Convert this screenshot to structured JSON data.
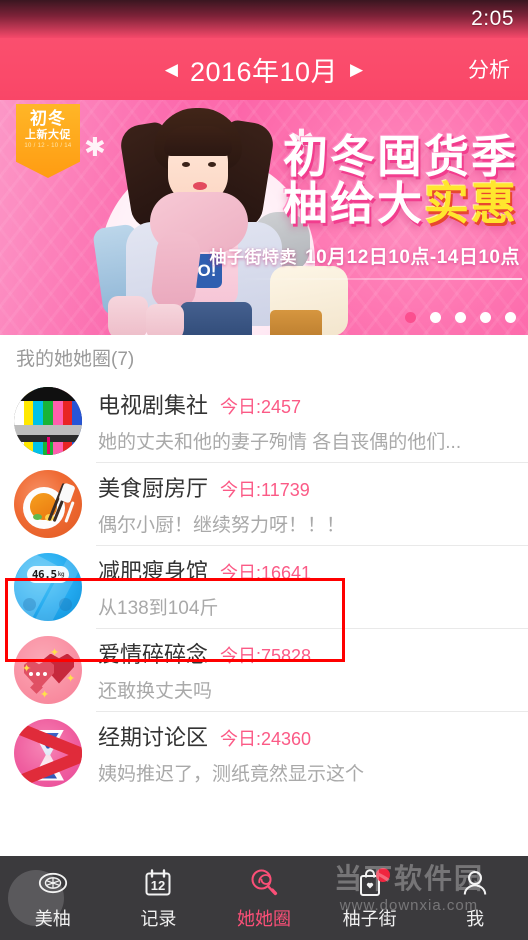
{
  "status_bar": {
    "time": "2:05"
  },
  "title_bar": {
    "prev_arrow": "◀",
    "month": "2016年10月",
    "next_arrow": "▶",
    "analyze": "分析"
  },
  "banner": {
    "ribbon_line1": "初冬",
    "ribbon_line2": "上新大促",
    "ribbon_line3": "10 / 12 - 10 / 14",
    "headline_1": "初冬囤货季",
    "headline_2_white": "柚给大",
    "headline_2_yellow": "实惠",
    "subtitle_tag": "柚子街特卖",
    "subtitle_time": "10月12日10点-14日10点",
    "shirt_logo": "O!",
    "dots_total": 5,
    "dots_active_index": 0
  },
  "section": {
    "header": "我的她她圈(7)"
  },
  "list": {
    "items": [
      {
        "avatar": "tv-test-pattern-icon",
        "title": "电视剧集社",
        "count": "今日:2457",
        "desc": "她的丈夫和他的妻子殉情 各自丧偶的他们..."
      },
      {
        "avatar": "food-plate-icon",
        "title": "美食厨房厅",
        "count": "今日:11739",
        "desc": "偶尔小厨！继续努力呀！！！"
      },
      {
        "avatar": "weight-scale-icon",
        "title": "减肥瘦身馆",
        "count": "今日:16641",
        "desc": "从138到104斤",
        "scale_reading": "46.5",
        "scale_unit": "kg"
      },
      {
        "avatar": "heart-chat-icon",
        "title": "爱情碎碎念",
        "count": "今日:75828",
        "desc": "还敢换丈夫吗"
      },
      {
        "avatar": "hourglass-icon",
        "title": "经期讨论区",
        "count": "今日:24360",
        "desc": "姨妈推迟了，测纸竟然显示这个"
      }
    ]
  },
  "tabbar": {
    "items": [
      {
        "icon": "pomelo-slice-icon",
        "label": "美柚",
        "active": false
      },
      {
        "icon": "calendar-icon",
        "label": "记录",
        "active": false,
        "calendar_day": "12"
      },
      {
        "icon": "lollipop-icon",
        "label": "她她圈",
        "active": true
      },
      {
        "icon": "shopping-bag-icon",
        "label": "柚子街",
        "active": false,
        "has_badge": true
      },
      {
        "icon": "person-icon",
        "label": "我",
        "active": false
      }
    ]
  },
  "watermark": {
    "name": "当下软件园",
    "url": "www.downxia.com"
  },
  "colors": {
    "brand_pink": "#fb4f77",
    "header_pink": "#fa4a6a",
    "count_pink": "#fb5a86",
    "annotation_red": "#ff0000",
    "tabbar_bg": "#3b3a3d"
  }
}
